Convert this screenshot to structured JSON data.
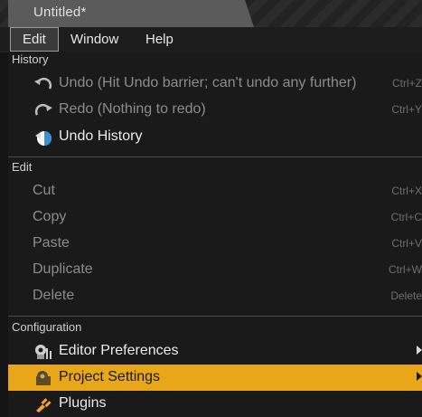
{
  "window": {
    "tab_title": "Untitled*"
  },
  "menubar": {
    "items": [
      "Edit",
      "Window",
      "Help"
    ],
    "active": "Edit"
  },
  "menu": {
    "history": {
      "header": "History",
      "undo": {
        "label": "Undo (Hit Undo barrier; can't undo any further)",
        "shortcut": "Ctrl+Z",
        "icon": "undo-icon",
        "enabled": false
      },
      "redo": {
        "label": "Redo (Nothing to redo)",
        "shortcut": "Ctrl+Y",
        "icon": "redo-icon",
        "enabled": false
      },
      "undo_history": {
        "label": "Undo History",
        "icon": "undo-history-icon",
        "enabled": true
      }
    },
    "edit": {
      "header": "Edit",
      "cut": {
        "label": "Cut",
        "shortcut": "Ctrl+X",
        "enabled": false
      },
      "copy": {
        "label": "Copy",
        "shortcut": "Ctrl+C",
        "enabled": false
      },
      "paste": {
        "label": "Paste",
        "shortcut": "Ctrl+V",
        "enabled": false
      },
      "duplicate": {
        "label": "Duplicate",
        "shortcut": "Ctrl+W",
        "enabled": false
      },
      "delete": {
        "label": "Delete",
        "shortcut": "Delete",
        "enabled": false
      }
    },
    "configuration": {
      "header": "Configuration",
      "editor_preferences": {
        "label": "Editor Preferences",
        "icon": "editor-preferences-icon",
        "submenu": true
      },
      "project_settings": {
        "label": "Project Settings",
        "icon": "project-settings-icon",
        "submenu": true,
        "highlighted": true
      },
      "plugins": {
        "label": "Plugins",
        "icon": "plugins-icon"
      }
    }
  },
  "colors": {
    "highlight": "#e8a719",
    "background": "#1a1a1a",
    "disabled_text": "#8c8c8c"
  }
}
